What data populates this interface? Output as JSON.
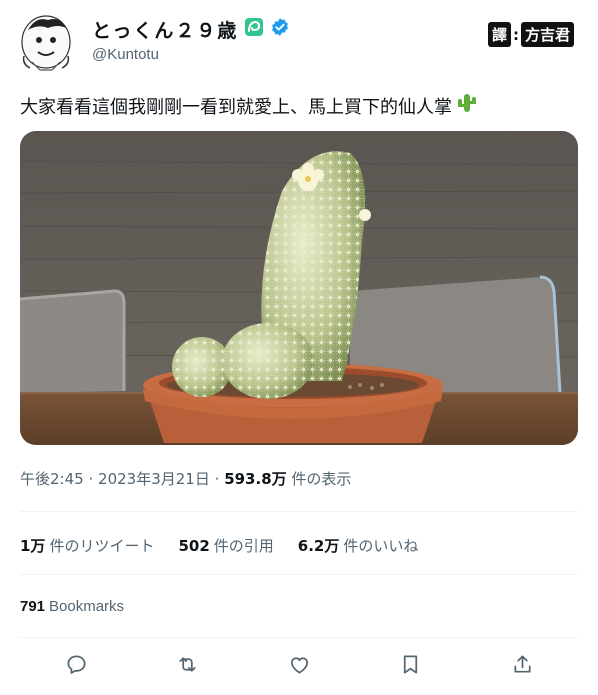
{
  "user": {
    "display_name": "とっくん２９歳",
    "handle": "@Kuntotu",
    "badge_icon": "leaf-icon",
    "verified_icon": "verified-badge-icon",
    "verified_color": "#1d9bf0",
    "badge_color": "#31c48d"
  },
  "watermark": {
    "left": "譯",
    "right": "方吉君"
  },
  "tweet": {
    "text": "大家看看這個我剛剛一看到就愛上、馬上買下的仙人掌",
    "emoji_icon": "cactus-icon"
  },
  "meta": {
    "time": "午後2:45",
    "separator": "·",
    "date": "2023年3月21日",
    "views_count": "593.8万",
    "views_label": "件の表示"
  },
  "stats": {
    "retweets_count": "1万",
    "retweets_label": "件のリツイート",
    "quotes_count": "502",
    "quotes_label": "件の引用",
    "likes_count": "6.2万",
    "likes_label": "件のいいね"
  },
  "bookmarks": {
    "count": "791",
    "label": "Bookmarks"
  },
  "actions": [
    {
      "name": "reply-icon"
    },
    {
      "name": "retweet-icon"
    },
    {
      "name": "like-icon"
    },
    {
      "name": "bookmark-icon"
    },
    {
      "name": "share-icon"
    }
  ],
  "colors": {
    "text_secondary": "#536471",
    "divider": "#eff3f4"
  }
}
